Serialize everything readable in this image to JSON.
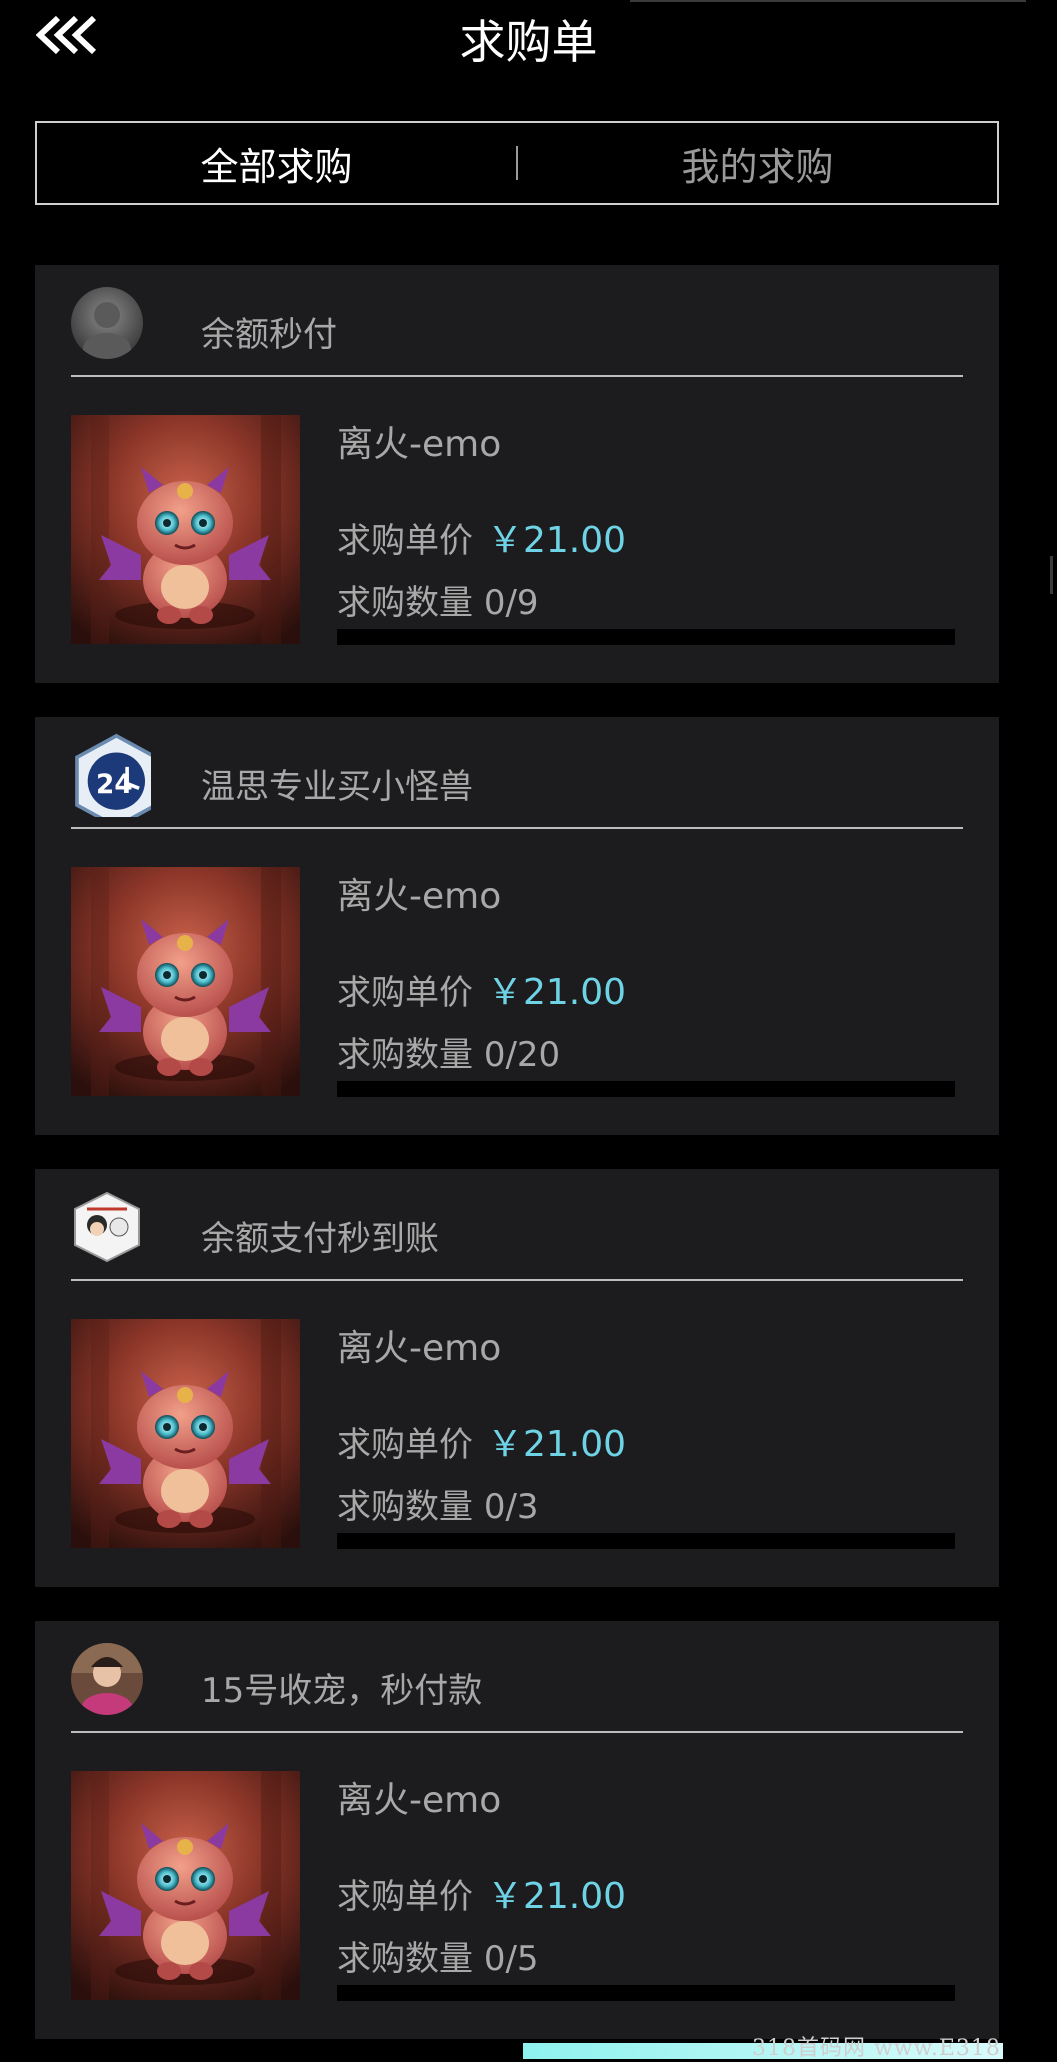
{
  "header": {
    "title": "求购单"
  },
  "tabs": [
    {
      "label": "全部求购",
      "active": true
    },
    {
      "label": "我的求购",
      "active": false
    }
  ],
  "orders": [
    {
      "seller": "余额秒付",
      "avatar_icon": "default-user-avatar",
      "product": "离火-emo",
      "price_label": "求购单价",
      "price": "￥21.00",
      "qty_label": "求购数量",
      "qty": "0/9",
      "progress": 0
    },
    {
      "seller": "温思专业买小怪兽",
      "avatar_icon": "24-hours-badge-avatar",
      "product": "离火-emo",
      "price_label": "求购单价",
      "price": "￥21.00",
      "qty_label": "求购数量",
      "qty": "0/20",
      "progress": 0
    },
    {
      "seller": "余额支付秒到账",
      "avatar_icon": "cartoon-badge-avatar",
      "product": "离火-emo",
      "price_label": "求购单价",
      "price": "￥21.00",
      "qty_label": "求购数量",
      "qty": "0/3",
      "progress": 0
    },
    {
      "seller": "15号收宠，秒付款",
      "avatar_icon": "photo-avatar",
      "product": "离火-emo",
      "price_label": "求购单价",
      "price": "￥21.00",
      "qty_label": "求购数量",
      "qty": "0/5",
      "progress": 0
    }
  ],
  "watermark": "318首码网 www.E318",
  "colors": {
    "background": "#000000",
    "card": "#1c1c1e",
    "price": "#6fd3e6",
    "muted_text": "#a8a8a8"
  }
}
